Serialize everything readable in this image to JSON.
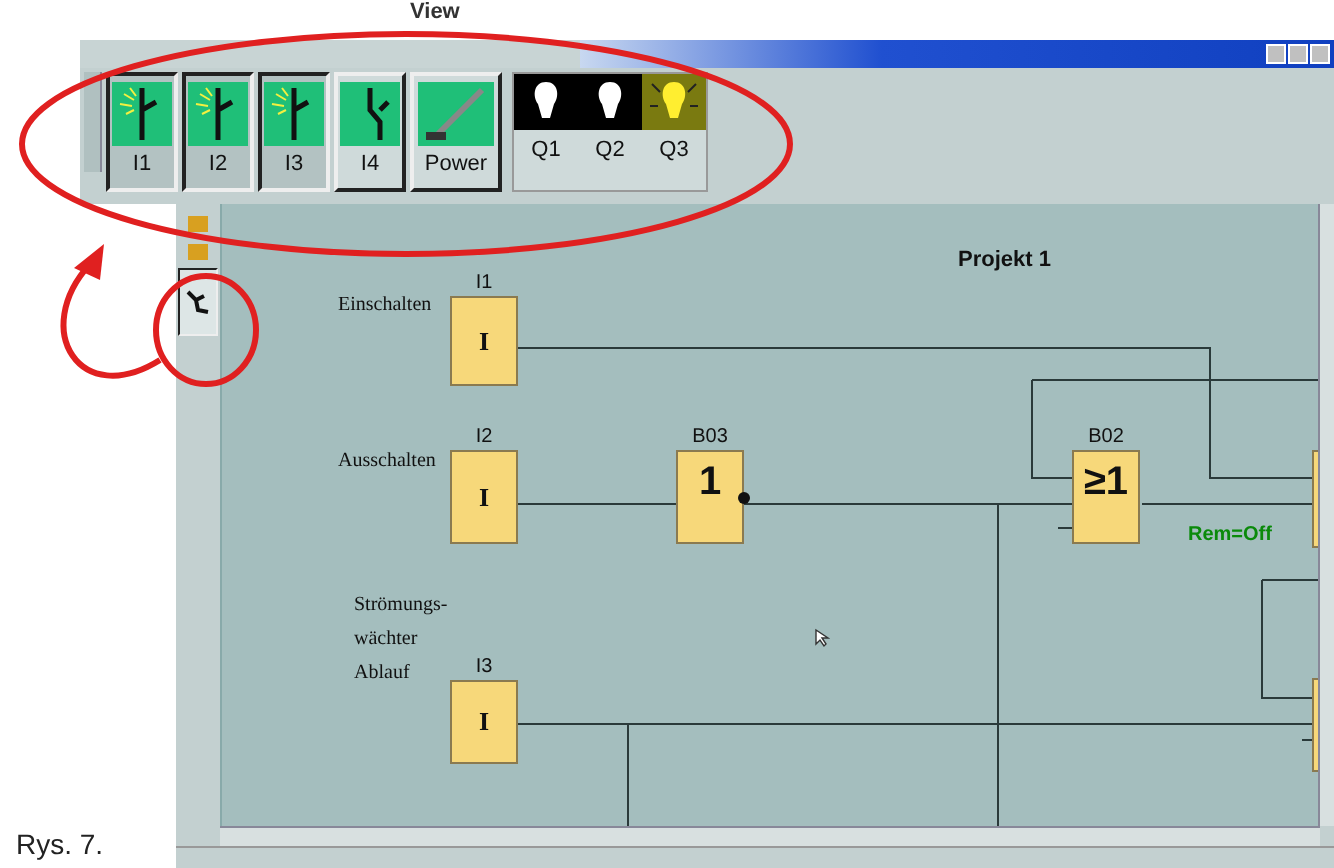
{
  "menu": [
    {
      "label": "View"
    }
  ],
  "toolbar": {
    "inputs": [
      {
        "label": "I1",
        "on": true
      },
      {
        "label": "I2",
        "on": true
      },
      {
        "label": "I3",
        "on": true
      },
      {
        "label": "I4",
        "on": false
      }
    ],
    "power": {
      "label": "Power"
    },
    "outputs": [
      {
        "label": "Q1",
        "on": false
      },
      {
        "label": "Q2",
        "on": false
      },
      {
        "label": "Q3",
        "on": true
      }
    ]
  },
  "diagram": {
    "title": "Projekt 1",
    "comments": [
      {
        "lines": [
          "Einschalten"
        ]
      },
      {
        "lines": [
          "Ausschalten"
        ]
      },
      {
        "lines": [
          "Strömungs-",
          "wächter",
          "Ablauf"
        ]
      }
    ],
    "blocks": [
      {
        "kind": "input",
        "name": "I1",
        "symbol": "I",
        "negated": false
      },
      {
        "kind": "input",
        "name": "I2",
        "symbol": "I",
        "negated": false
      },
      {
        "kind": "input",
        "name": "I3",
        "symbol": "I",
        "negated": false
      },
      {
        "kind": "gate",
        "name": "B03",
        "symbol": "1",
        "negated": true
      },
      {
        "kind": "gate",
        "name": "B02",
        "symbol": "≥1",
        "negated": false
      }
    ],
    "remanence": "Rem=Off"
  },
  "caption": "Rys. 7."
}
